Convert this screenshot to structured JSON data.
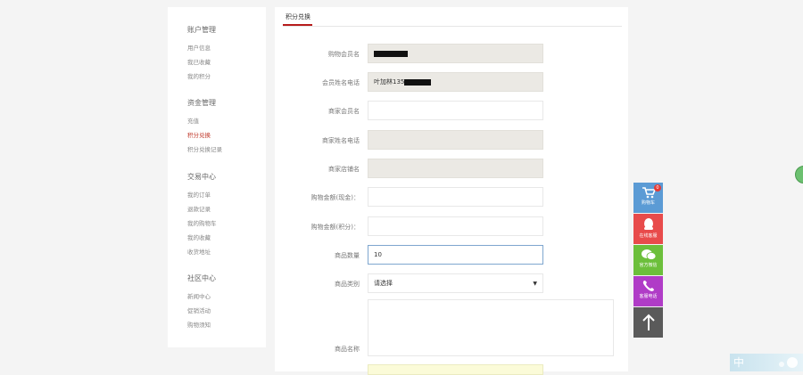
{
  "sidebar": {
    "sections": [
      {
        "title": "账户管理",
        "items": [
          {
            "label": "用户信息",
            "active": false
          },
          {
            "label": "我已收藏",
            "active": false
          },
          {
            "label": "我的积分",
            "active": false
          }
        ]
      },
      {
        "title": "资金管理",
        "items": [
          {
            "label": "充值",
            "active": false
          },
          {
            "label": "积分兑换",
            "active": true
          },
          {
            "label": "积分兑换记录",
            "active": false
          }
        ]
      },
      {
        "title": "交易中心",
        "items": [
          {
            "label": "我的订单",
            "active": false
          },
          {
            "label": "退款记录",
            "active": false
          },
          {
            "label": "我的购物车",
            "active": false
          },
          {
            "label": "我的收藏",
            "active": false
          },
          {
            "label": "收货地址",
            "active": false
          }
        ]
      },
      {
        "title": "社区中心",
        "items": [
          {
            "label": "新闻中心",
            "active": false
          },
          {
            "label": "促销活动",
            "active": false
          },
          {
            "label": "购物须知",
            "active": false
          }
        ]
      }
    ]
  },
  "tabs": [
    {
      "label": "积分兑换",
      "active": true
    }
  ],
  "form": {
    "member_name_label": "购物会员名",
    "member_phone_label": "会员姓名电话",
    "member_phone_prefix": "叶加林135",
    "merchant_member_label": "商家会员名",
    "merchant_phone_label": "商家姓名电话",
    "merchant_shop_label": "商家店铺名",
    "cash_amount_label": "购物金额(现金)：",
    "points_amount_label": "购物金额(积分)：",
    "quantity_label": "商品数量",
    "quantity_value": "10",
    "category_label": "商品类别",
    "category_value": "请选择",
    "product_name_label": "商品名称"
  },
  "float_bar": {
    "cart": {
      "label": "购物车",
      "count": "0"
    },
    "chat": {
      "label": "在线客服"
    },
    "wechat": {
      "label": "官方微信"
    },
    "phone": {
      "label": "客服电话"
    }
  },
  "corner_widget": {
    "text": "中"
  },
  "colors": {
    "cart": "#5b9bd5",
    "chat": "#e84b4b",
    "wechat": "#6cbf3b",
    "phone": "#b03cc7",
    "top": "#5a5a5a",
    "accent": "#b71c1c"
  }
}
